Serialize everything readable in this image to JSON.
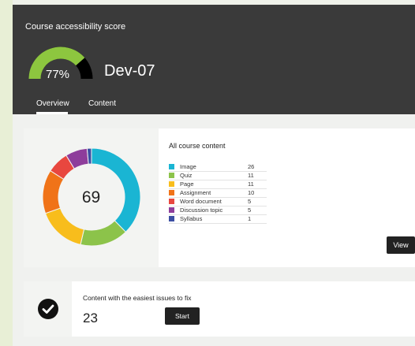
{
  "header": {
    "title": "Course accessibility score",
    "score_label": "77%",
    "score": 0.77,
    "course_name": "Dev-07",
    "tabs": [
      {
        "label": "Overview"
      },
      {
        "label": "Content"
      }
    ],
    "gauge_color": "#8dc63f"
  },
  "content_card": {
    "total": "69",
    "title": "All course content",
    "items": [
      {
        "label": "Image",
        "count": "26",
        "color": "#1ab5d3"
      },
      {
        "label": "Quiz",
        "count": "11",
        "color": "#8cc34a"
      },
      {
        "label": "Page",
        "count": "11",
        "color": "#f8bd1c"
      },
      {
        "label": "Assignment",
        "count": "10",
        "color": "#f07318"
      },
      {
        "label": "Word document",
        "count": "5",
        "color": "#e8473f"
      },
      {
        "label": "Discussion topic",
        "count": "5",
        "color": "#8e3d9b"
      },
      {
        "label": "Syllabus",
        "count": "1",
        "color": "#3b4ea3"
      }
    ],
    "view_label": "View"
  },
  "issues_card": {
    "title": "Content with the easiest issues to fix",
    "count": "23",
    "start_label": "Start"
  }
}
